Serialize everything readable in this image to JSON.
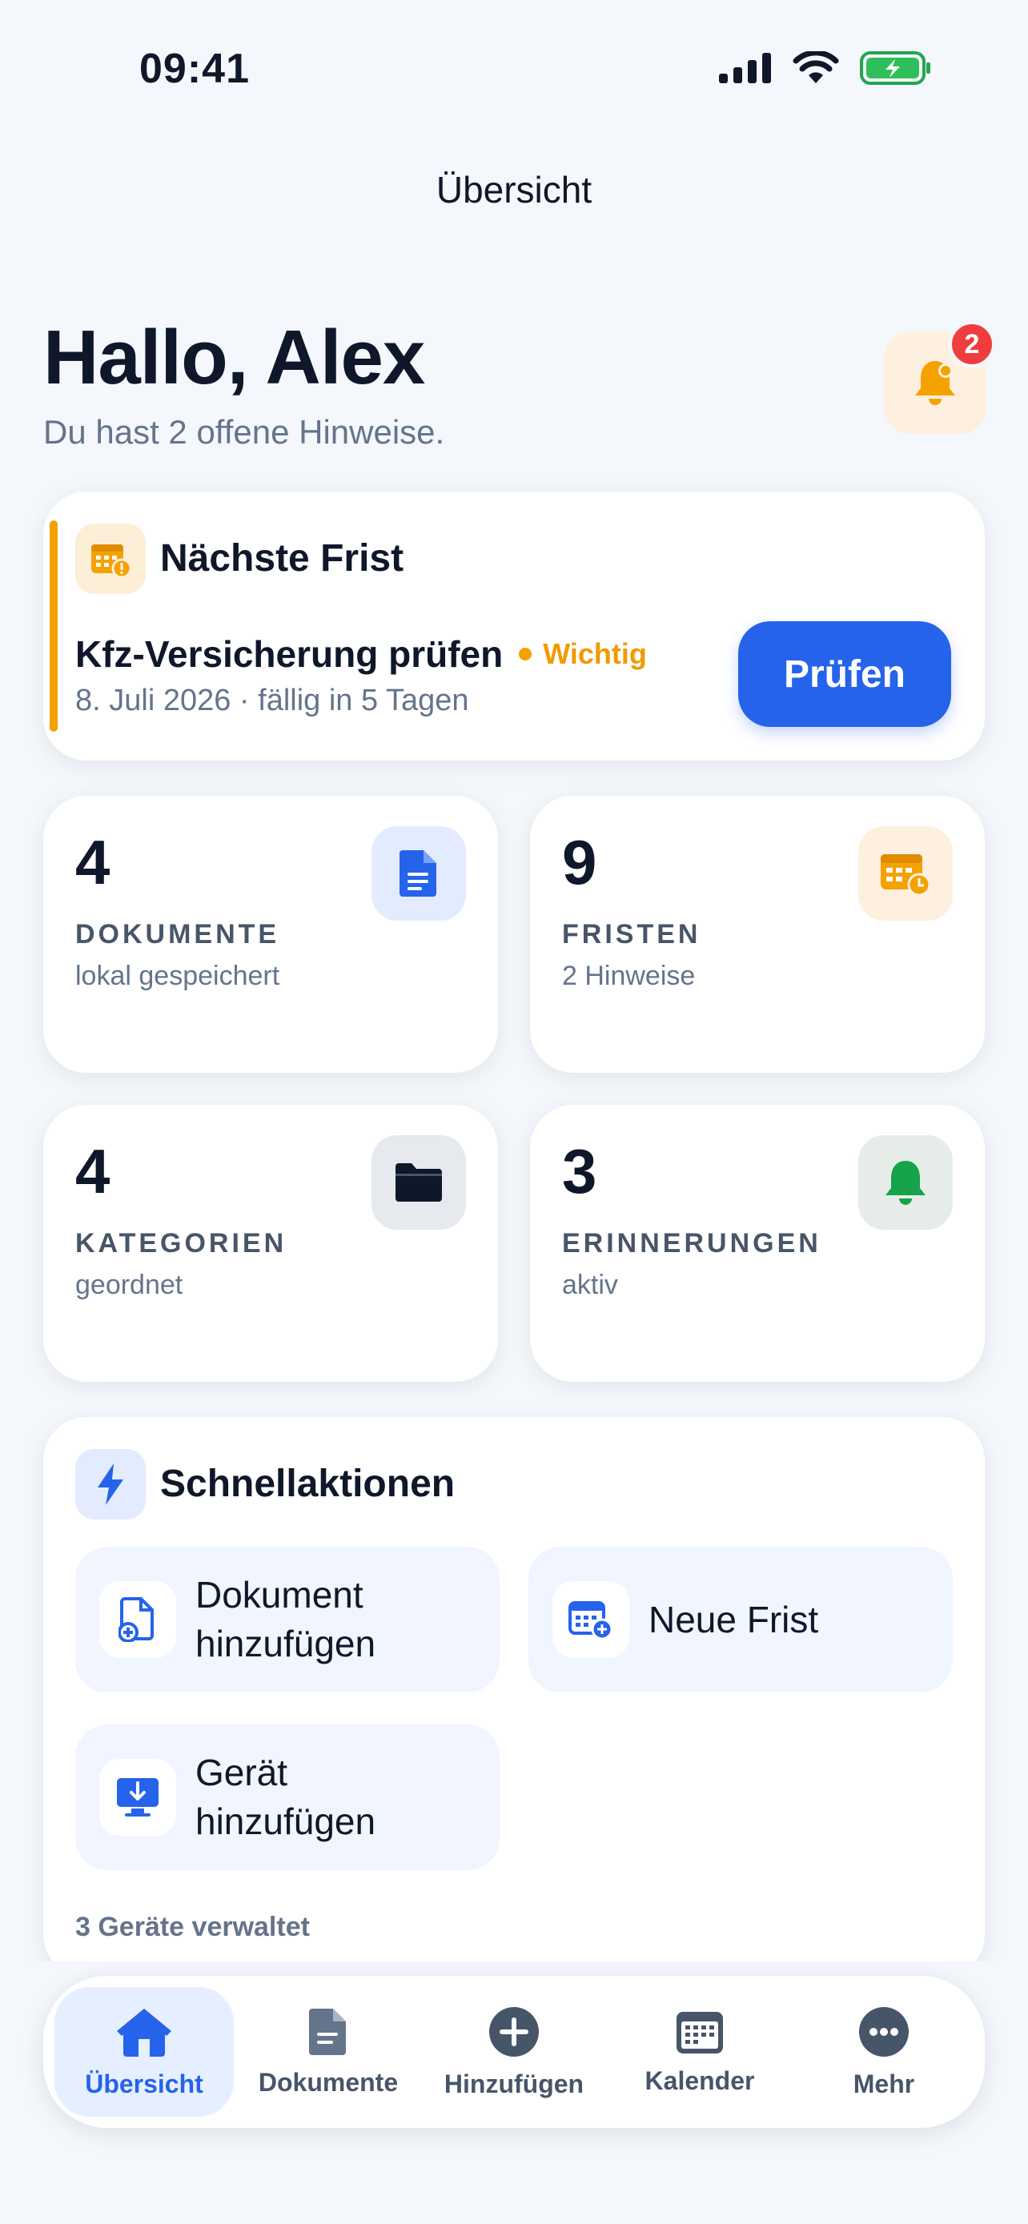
{
  "status_bar": {
    "time": "09:41"
  },
  "header": {
    "title": "Übersicht"
  },
  "greeting": {
    "title": "Hallo, Alex",
    "subtitle": "Du hast 2 offene Hinweise.",
    "notification_count": "2"
  },
  "next_deadline": {
    "title": "Nächste Frist",
    "task": "Kfz-Versicherung prüfen",
    "tag": "Wichtig",
    "date": "8. Juli 2026 · fällig in 5 Tagen",
    "button": "Prüfen",
    "accent_color": "#f5a100"
  },
  "stats": [
    {
      "value": "4",
      "label": "DOKUMENTE",
      "sub": "lokal gespeichert",
      "icon": "document-icon"
    },
    {
      "value": "9",
      "label": "FRISTEN",
      "sub": "2 Hinweise",
      "icon": "calendar-clock-icon"
    },
    {
      "value": "4",
      "label": "KATEGORIEN",
      "sub": "geordnet",
      "icon": "folder-icon"
    },
    {
      "value": "3",
      "label": "ERINNERUNGEN",
      "sub": "aktiv",
      "icon": "bell-icon"
    }
  ],
  "quick_actions": {
    "title": "Schnellaktionen",
    "items": [
      {
        "label_line1": "Dokument",
        "label_line2": "hinzufügen",
        "icon": "add-document-icon"
      },
      {
        "label": "Neue Frist",
        "icon": "add-calendar-icon"
      },
      {
        "label_line1": "Gerät",
        "label_line2": "hinzufügen",
        "icon": "add-device-icon"
      }
    ],
    "footer": "3 Geräte verwaltet"
  },
  "tabbar": [
    {
      "label": "Übersicht",
      "icon": "home-icon",
      "active": true
    },
    {
      "label": "Dokumente",
      "icon": "document-icon"
    },
    {
      "label": "Hinzufügen",
      "icon": "plus-circle-icon"
    },
    {
      "label": "Kalender",
      "icon": "calendar-icon"
    },
    {
      "label": "Mehr",
      "icon": "more-icon"
    }
  ],
  "colors": {
    "primary": "#2563eb",
    "warning": "#f5a100",
    "danger": "#ef3d3d",
    "success": "#16a34a"
  }
}
